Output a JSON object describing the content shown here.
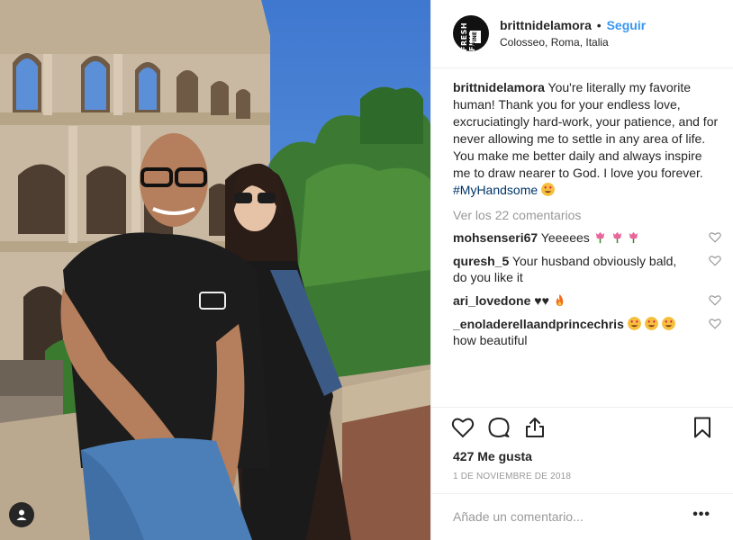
{
  "post": {
    "username": "brittnidelamora",
    "separator": "•",
    "follow_label": "Seguir",
    "location": "Colosseo, Roma, Italia",
    "avatar_label": "FRESH FINE",
    "avatar_label_2": "FINE",
    "caption_text": " You're literally my favorite human! Thank you for your endless love, excruciatingly hard-work, your patience, and for never allowing me to settle in any area of life. You make me better daily and always inspire me to draw nearer to God. I love you forever. ",
    "caption_hashtag": "#MyHandsome",
    "view_all_comments": "Ver los 22 comentarios",
    "comments": [
      {
        "user": "mohsenseri67",
        "text": " Yeeeees"
      },
      {
        "user": "quresh_5",
        "text": " Your husband obviously bald, do you like it"
      },
      {
        "user": "ari_lovedone",
        "text": " ♥♥"
      },
      {
        "user": "_enoladerellaandprincechris",
        "text": "how beautiful"
      }
    ],
    "likes": "427 Me gusta",
    "date": "1 DE NOVIEMBRE DE 2018",
    "add_comment_placeholder": "Añade un comentario...",
    "more_label": "•••"
  },
  "icons": {
    "like": "heart-outline-icon",
    "comment": "speech-bubble-icon",
    "share": "share-upload-icon",
    "save": "bookmark-icon",
    "user_tags": "user-tag-icon"
  },
  "colors": {
    "link_blue": "#3897f0",
    "hashtag": "#003569",
    "muted": "#999999",
    "text": "#262626",
    "border": "#efefef"
  }
}
